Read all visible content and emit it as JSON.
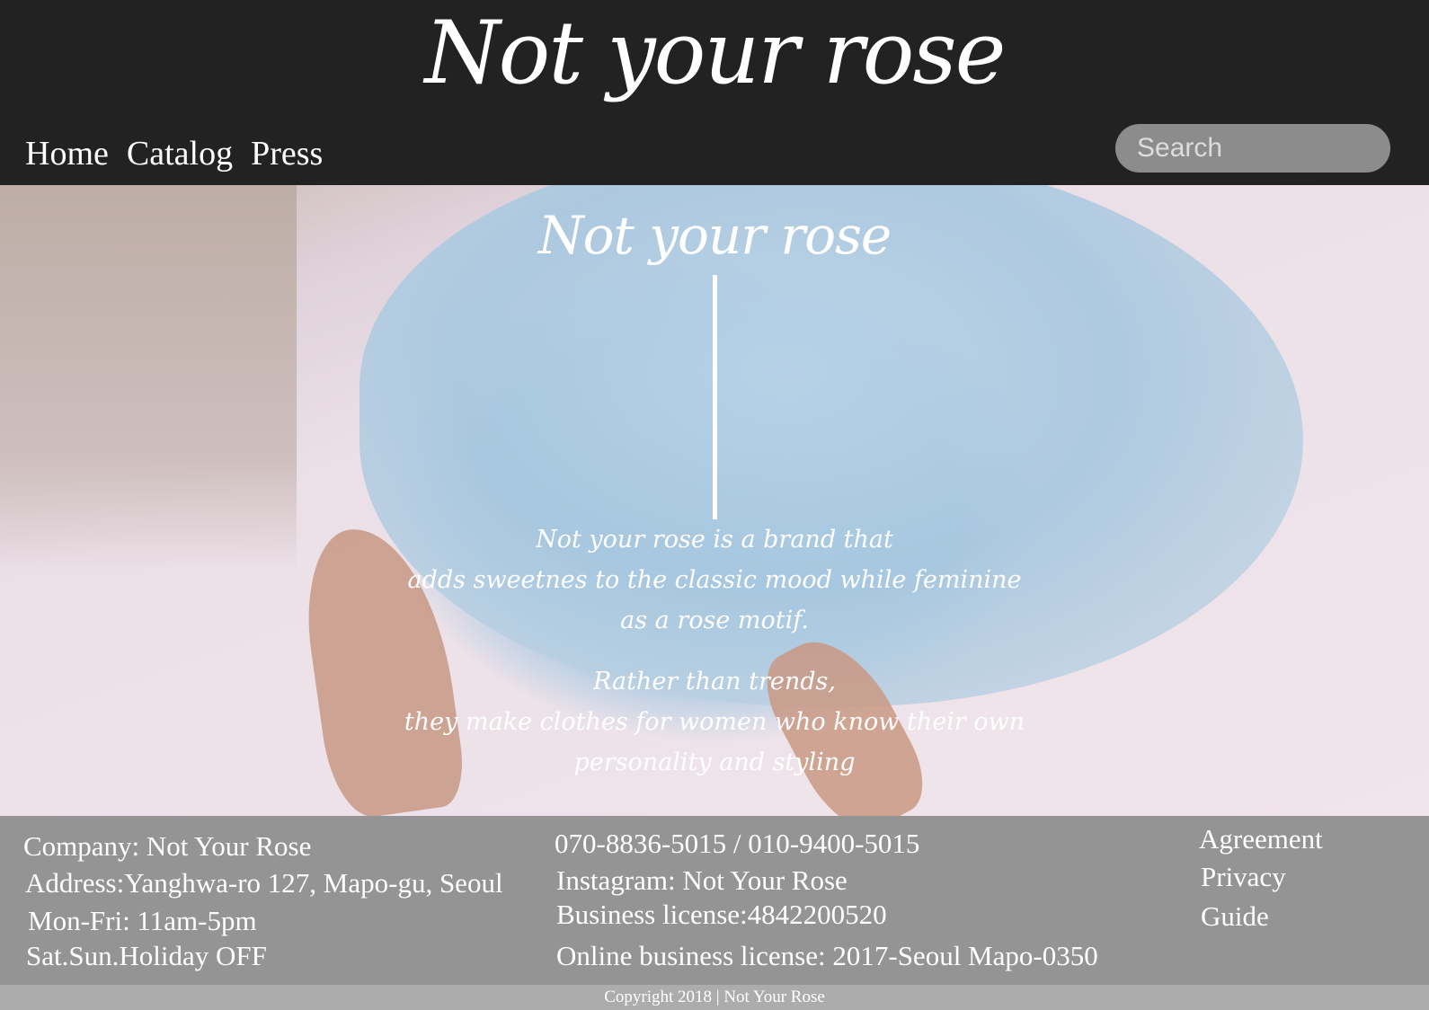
{
  "header": {
    "logo": "Not your rose",
    "nav": [
      "Home",
      "Catalog",
      "Press"
    ],
    "search_placeholder": "Search"
  },
  "hero": {
    "title": "Not your rose",
    "paragraph1": [
      "Not your rose is a brand that",
      "adds sweetnes to the classic mood while feminine",
      "as a rose motif."
    ],
    "paragraph2": [
      "Rather than trends,",
      "they make clothes for women who know their own",
      "personality and styling"
    ]
  },
  "footer": {
    "company": "Company: Not Your Rose",
    "address": "Address:Yanghwa-ro 127, Mapo-gu, Seoul",
    "hours_weekday": "Mon-Fri: 11am-5pm",
    "hours_weekend": "Sat.Sun.Holiday OFF",
    "phone": "070-8836-5015 / 010-9400-5015",
    "instagram": "Instagram: Not Your Rose",
    "business_license": "Business license:4842200520",
    "online_license": "Online business license: 2017-Seoul Mapo-0350",
    "links": [
      "Agreement",
      "Privacy",
      "Guide"
    ],
    "copyright": "Copyright 2018 | Not Your Rose"
  },
  "colors": {
    "header_bg": "#222222",
    "footer_bg": "#949494",
    "search_bg": "#8c8c8c",
    "dress_blue": "#86c0de"
  }
}
